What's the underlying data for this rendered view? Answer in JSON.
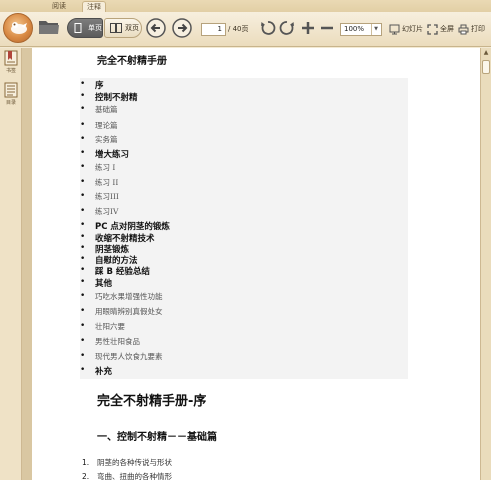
{
  "tabs": [
    {
      "label": "阅读"
    },
    {
      "label": "注释"
    }
  ],
  "toolbar": {
    "single_page_label": "单页",
    "double_page_label": "双页",
    "current_page": "1",
    "total_pages": "/ 40页",
    "zoom": "100%",
    "slideshow_label": "幻灯片",
    "fullscreen_label": "全屏",
    "print_label": "打印"
  },
  "sidebar": {
    "bookmark_label": "书签",
    "toc_label": "目录"
  },
  "document": {
    "title": "完全不射精手册",
    "toc": [
      {
        "text": "序",
        "style": "b"
      },
      {
        "text": "控制不射精",
        "style": "b"
      },
      {
        "text": "基础篇",
        "style": "s"
      },
      {
        "text": "理论篇",
        "style": "s"
      },
      {
        "text": "实务篇",
        "style": "s"
      },
      {
        "text": "增大练习",
        "style": "b"
      },
      {
        "text": "练习 I",
        "style": "s"
      },
      {
        "text": "练习 II",
        "style": "s"
      },
      {
        "text": "练习III",
        "style": "s"
      },
      {
        "text": "练习IV",
        "style": "s"
      },
      {
        "text": "PC 点对阴茎的锻炼",
        "style": "b"
      },
      {
        "text": "收缩不射精技术",
        "style": "b"
      },
      {
        "text": "阴茎锻炼",
        "style": "b"
      },
      {
        "text": "自慰的方法",
        "style": "b"
      },
      {
        "text": "踩 B 经验总结",
        "style": "b"
      },
      {
        "text": "其他",
        "style": "b"
      },
      {
        "text": "巧吃水果增强性功能",
        "style": "s"
      },
      {
        "text": "用眼睛辨别真假处女",
        "style": "s"
      },
      {
        "text": "壮阳六要",
        "style": "s"
      },
      {
        "text": "男性壮阳食品",
        "style": "s"
      },
      {
        "text": "现代男人饮食九要素",
        "style": "s"
      },
      {
        "text": "补充",
        "style": "b"
      }
    ],
    "heading1": "完全不射精手册-序",
    "heading2": "一、控制不射精－－基础篇",
    "list": [
      {
        "num": "1.",
        "text": "阴茎的各种传说与形状"
      },
      {
        "num": "2.",
        "text": "弯曲、扭曲的各种情形"
      }
    ]
  }
}
